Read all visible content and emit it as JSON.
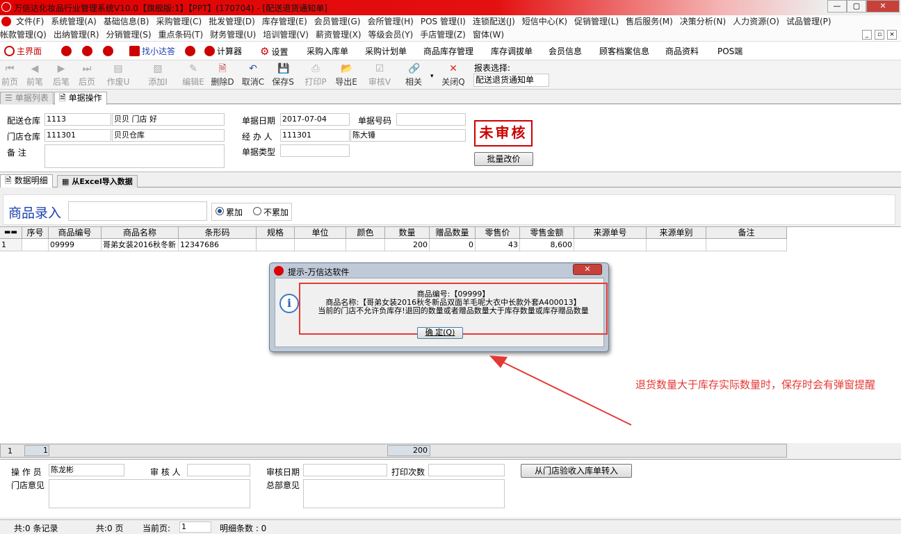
{
  "window": {
    "title": "万信达化妆品行业管理系统V10.0【旗舰版:1】【PPT】(170704) - [配送退货通知单]",
    "controls": [
      "—",
      "▢",
      "✕"
    ]
  },
  "menu1": [
    "文件(F)",
    "系统管理(A)",
    "基础信息(B)",
    "采购管理(C)",
    "批发管理(D)",
    "库存管理(E)",
    "会员管理(G)",
    "会所管理(H)",
    "POS 管理(I)",
    "连锁配送(J)",
    "短信中心(K)",
    "促销管理(L)",
    "售后服务(M)",
    "决策分析(N)",
    "人力资源(O)",
    "试品管理(P)"
  ],
  "menu2": [
    "帐款管理(Q)",
    "出纳管理(R)",
    "分销管理(S)",
    "重点条码(T)",
    "财务管理(U)",
    "培训管理(V)",
    "薪资管理(X)",
    "等级会员(Y)",
    "手店管理(Z)",
    "窗体(W)"
  ],
  "quickbar": [
    "主界面",
    "",
    "",
    "",
    "找小达答",
    "",
    "计算器",
    "设置",
    "采购入库单",
    "采购计划单",
    "商品库存管理",
    "库存调拔单",
    "会员信息",
    "顾客档案信息",
    "商品资料",
    "POS端"
  ],
  "toolbar": {
    "buttons": [
      "前页",
      "前笔",
      "后笔",
      "后页",
      "作废U",
      "添加I",
      "编辑E",
      "删除D",
      "取消C",
      "保存S",
      "打印P",
      "导出E",
      "审核V",
      "相关",
      "关闭Q"
    ],
    "report_label": "报表选择:",
    "report_value": "配送退货通知单"
  },
  "tabs": {
    "list": "单据列表",
    "ops": "单据操作",
    "detail": "数据明细",
    "excel": "从Excel导入数据"
  },
  "header": {
    "ship_wh_label": "配送仓库",
    "ship_wh_code": "1113",
    "ship_wh_name": "贝贝 门店 好",
    "store_wh_label": "门店仓库",
    "store_wh_code": "111301",
    "store_wh_name": "贝贝仓库",
    "remark_label": "备    注",
    "date_label": "单据日期",
    "date_value": "2017-07-04",
    "no_label": "单据号码",
    "no_value": "",
    "handler_label": "经 办 人",
    "handler_code": "111301",
    "handler_name": "陈大锤",
    "type_label": "单据类型",
    "type_value": "",
    "stamp": "未审核",
    "batch_btn": "批量改价"
  },
  "entry": {
    "label": "商品录入",
    "opt_accumulate": "累加",
    "opt_noaccumulate": "不累加"
  },
  "grid": {
    "headers": [
      "序号",
      "商品编号",
      "商品名称",
      "条形码",
      "规格",
      "单位",
      "颜色",
      "数量",
      "赠品数量",
      "零售价",
      "零售金额",
      "来源单号",
      "来源单别",
      "备注"
    ],
    "rows": [
      [
        "1",
        "09999",
        "哥弟女装2016秋冬新",
        "12347686",
        "",
        "",
        "",
        "200",
        "0",
        "43",
        "8,600",
        "",
        "",
        ""
      ]
    ],
    "footer_count": "1",
    "footer_seq": "1",
    "footer_qty": "200"
  },
  "bottom": {
    "operator_label": "操 作 员",
    "operator_value": "陈龙彬",
    "auditor_label": "审 核 人",
    "auditor_value": "",
    "audit_date_label": "审核日期",
    "audit_date_value": "",
    "print_count_label": "打印次数",
    "print_count_value": "",
    "transfer_btn": "从门店验收入库单转入",
    "store_opinion_label": "门店意见",
    "hq_opinion_label": "总部意见"
  },
  "status": {
    "records": "共:0 条记录",
    "pages": "共:0 页",
    "current_label": "当前页:",
    "current_value": "1",
    "detail_count": "明细条数 : 0"
  },
  "dialog": {
    "title": "提示-万信达软件",
    "line1": "商品编号:【09999】",
    "line2": "商品名称:【哥弟女装2016秋冬新品双面羊毛呢大衣中长款外套A400013】",
    "line3": "当前的门店不允许负库存!退回的数量或者赠品数量大于库存数量或库存赠品数量",
    "ok": "确 定(Q)",
    "close": "✕"
  },
  "annotation": {
    "text": "退货数量大于库存实际数量时，保存时会有弹窗提醒",
    "color": "#e53935"
  }
}
